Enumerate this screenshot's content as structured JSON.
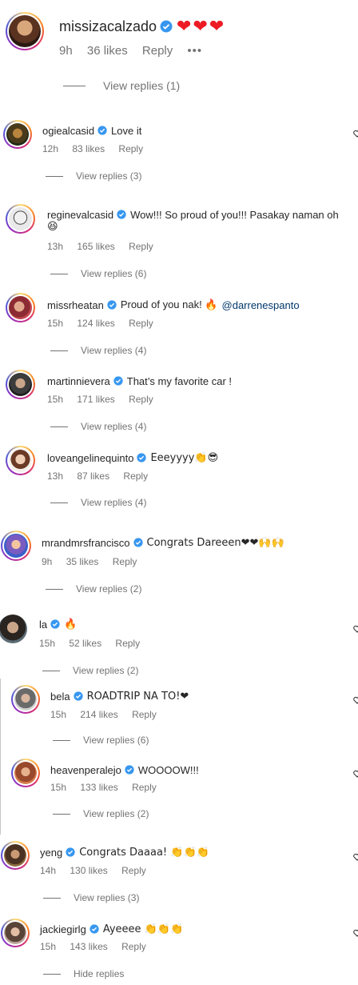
{
  "header": {
    "username": "missizacalzado",
    "hearts": "❤❤❤",
    "time": "9h",
    "likes": "36 likes",
    "reply": "Reply",
    "more": "•••",
    "view_replies": "View replies (1)"
  },
  "comments": [
    {
      "username": "ogiealcasid",
      "text": "Love it",
      "time": "12h",
      "likes": "83 likes",
      "reply": "Reply",
      "view": "View replies (3)"
    },
    {
      "username": "reginevalcasid",
      "text": "Wow!!! So proud of you!!! Pasakay naman oh",
      "text2": "😆",
      "time": "13h",
      "likes": "165 likes",
      "reply": "Reply",
      "view": "View replies (6)"
    },
    {
      "username": "missrheatan",
      "text": "Proud of you nak! 🔥",
      "mention": "@darrenespanto",
      "time": "15h",
      "likes": "124 likes",
      "reply": "Reply",
      "view": "View replies (4)"
    },
    {
      "username": "martinnievera",
      "text": "That’s my favorite car !",
      "time": "15h",
      "likes": "171 likes",
      "reply": "Reply",
      "view": "View replies (4)"
    },
    {
      "username": "loveangelinequinto",
      "text": "Eeeyyyy👏😎",
      "time": "13h",
      "likes": "87 likes",
      "reply": "Reply",
      "view": "View replies (4)"
    },
    {
      "username": "mrandmrsfrancisco",
      "text": "Congrats Dareeen❤❤🙌🙌",
      "time": "9h",
      "likes": "35 likes",
      "reply": "Reply",
      "view": "View replies (2)"
    },
    {
      "username": "la",
      "text": "🔥",
      "time": "15h",
      "likes": "52 likes",
      "reply": "Reply",
      "view": "View replies (2)"
    },
    {
      "username": "bela",
      "text": "ROADTRIP NA TO!❤",
      "time": "15h",
      "likes": "214 likes",
      "reply": "Reply",
      "view": "View replies (6)"
    },
    {
      "username": "heavenperalejo",
      "text": "WOOOOW!!!",
      "time": "15h",
      "likes": "133 likes",
      "reply": "Reply",
      "view": "View replies (2)"
    },
    {
      "username": "yeng",
      "text": "Congrats Daaaa! 👏👏👏",
      "time": "14h",
      "likes": "130 likes",
      "reply": "Reply",
      "view": "View replies (3)"
    },
    {
      "username": "jackiegirlg",
      "text": "Ayeeee 👏👏👏",
      "time": "15h",
      "likes": "143 likes",
      "reply": "Reply",
      "view": "Hide replies"
    }
  ],
  "colors": {
    "verified": "#3797f0",
    "heart": "#ed1c24",
    "muted": "#737373",
    "text": "#262626",
    "mention": "#00376b"
  },
  "icons": {
    "verified": "verified-badge-icon",
    "like": "heart-outline-icon",
    "more": "more-options-icon"
  }
}
